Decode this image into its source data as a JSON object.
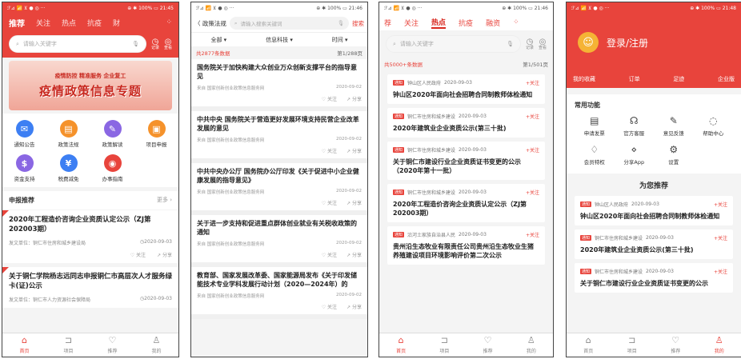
{
  "status": {
    "s1": {
      "left": "ℱ⊿ 📶 ⊻ ● ◎ ···",
      "right": "⊕ ✱ 100% ▭ 21:45"
    },
    "s2": {
      "left": "ℱ⊿ 📶 ⊻ ● ◎ ···",
      "right": "⊕ ✱ 100% ▭ 21:46"
    },
    "s3": {
      "left": "ℱ⊿ 📶 ⊻ ● ◎ ···",
      "right": "⊕ ✱ 100% ▭ 21:46"
    },
    "s4": {
      "left": "ℱ⊿ 📶 ⊻ ● ◎ ···",
      "right": "⊕ ✱ 100% ▭ 21:48"
    }
  },
  "home": {
    "nav": [
      "推荐",
      "关注",
      "热点",
      "抗疫",
      "财"
    ],
    "search_placeholder": "请输入关键字",
    "mini_record": "记录",
    "mini_scan": "查看",
    "banner_small": "疫情防控 精准服务 企业复工",
    "banner_title": "疫情政策信息专题",
    "grid": [
      {
        "label": "通知公告",
        "color": "#3d7ff3",
        "glyph": "✉"
      },
      {
        "label": "政策法规",
        "color": "#f5922b",
        "glyph": "▤"
      },
      {
        "label": "政策解读",
        "color": "#8a67e3",
        "glyph": "✎"
      },
      {
        "label": "项目申报",
        "color": "#f5922b",
        "glyph": "▣"
      },
      {
        "label": "资金支持",
        "color": "#8a67e3",
        "glyph": "$"
      },
      {
        "label": "税费减免",
        "color": "#3d7ff3",
        "glyph": "¥"
      },
      {
        "label": "办事指南",
        "color": "#e8443c",
        "glyph": "◉"
      }
    ],
    "section": "申报推荐",
    "more": "更多 ›",
    "cards": [
      {
        "title": "2020年工程造价咨询企业资质认定公示（ZJ第202003期）",
        "unit": "发文单位：铜仁市住房和城乡建设局",
        "date": "◷2020-09-03",
        "fav": "♡ 关注",
        "share": "↗ 分享"
      },
      {
        "title": "关于铜仁学院杨志远同志申报铜仁市高层次人才服务绿卡(证)公示",
        "unit": "发文单位：铜仁市人力资源社会保障局",
        "date": "◷2020-09-03"
      }
    ]
  },
  "tabs": [
    "首页",
    "项目",
    "推荐",
    "我的"
  ],
  "list": {
    "back": "〈 政策法规",
    "search_placeholder": "请输入搜索关键词",
    "search_btn": "搜索",
    "filters": [
      "全部 ▾",
      "信息科技 ▾",
      "时间 ▾"
    ],
    "count": "共2877条数据",
    "page": "第1/288页",
    "items": [
      {
        "title": "国务院关于加快构建大众创业万众创新支撑平台的指导意见",
        "src": "来自 国家创新创业政策信息服务网",
        "date": "2020-09-02"
      },
      {
        "title": "中共中央 国务院关于营造更好发展环境支持民营企业改革发展的意见",
        "src": "来自 国家创新创业政策信息服务网",
        "date": "2020-09-02"
      },
      {
        "title": "中共中央办公厅 国务院办公厅印发《关于促进中小企业健康发展的指导意见》",
        "src": "来自 国家创新创业政策信息服务网",
        "date": "2020-09-02"
      },
      {
        "title": "关于进一步支持和促进重点群体创业就业有关税收政策的通知",
        "src": "来自 国家创新创业政策信息服务网",
        "date": "2020-09-02"
      },
      {
        "title": "教育部、国家发展改革委、国家能源局发布《关于印发储能技术专业学科发展行动计划（2020—2024年）的",
        "src": "来自 国家创新创业政策信息服务网",
        "date": "2020-09-02"
      }
    ],
    "fav": "♡ 关注",
    "share": "↗ 分享"
  },
  "hot": {
    "nav": [
      "荐",
      "关注",
      "热点",
      "抗疫",
      "融资"
    ],
    "search_placeholder": "请输入关键字",
    "count": "共5000+条数据",
    "page": "第1/501页",
    "tag": "通知",
    "follow": "+关注",
    "items": [
      {
        "src": "钟山区人民政府",
        "date": "2020-09-03",
        "title": "钟山区2020年面向社会招聘合同制教师体检通知"
      },
      {
        "src": "铜仁市住房和城乡建设",
        "date": "2020-09-03",
        "title": "2020年建筑业企业资质公示(第三十批)"
      },
      {
        "src": "铜仁市住房和城乡建设",
        "date": "2020-09-03",
        "title": "关于铜仁市建设行业企业资质证书变更的公示（2020年第十一批）"
      },
      {
        "src": "铜仁市住房和城乡建设",
        "date": "2020-09-03",
        "title": "2020年工程造价咨询企业资质认定公示（ZJ第202003期）"
      },
      {
        "src": "沿河土家族自治县人民",
        "date": "2020-09-03",
        "title": "贵州沿生态牧业有限责任公司贵州沿生态牧业生猪养殖建设项目环境影响评价第二次公示"
      }
    ]
  },
  "me": {
    "login": "登录/注册",
    "links": [
      "我的收藏",
      "订单",
      "足迹",
      "企业版"
    ],
    "func_title": "常用功能",
    "funcs": [
      {
        "label": "申请发票",
        "glyph": "▤"
      },
      {
        "label": "官方客服",
        "glyph": "☊"
      },
      {
        "label": "意见反馈",
        "glyph": "✎"
      },
      {
        "label": "帮助中心",
        "glyph": "◌"
      },
      {
        "label": "会员特权",
        "glyph": "♢"
      },
      {
        "label": "分享App",
        "glyph": "⋄"
      },
      {
        "label": "设置",
        "glyph": "⚙"
      }
    ],
    "rec_title": "为您推荐",
    "items": [
      {
        "src": "钟山区人民政府",
        "date": "2020-09-03",
        "title": "钟山区2020年面向社会招聘合同制教师体检通知"
      },
      {
        "src": "铜仁市住房和城乡建设",
        "date": "2020-09-03",
        "title": "2020年建筑业企业资质公示(第三十批)"
      },
      {
        "src": "铜仁市住房和城乡建设",
        "date": "2020-09-03",
        "title": "关于铜仁市建设行业企业资质证书变更的公示"
      }
    ]
  }
}
